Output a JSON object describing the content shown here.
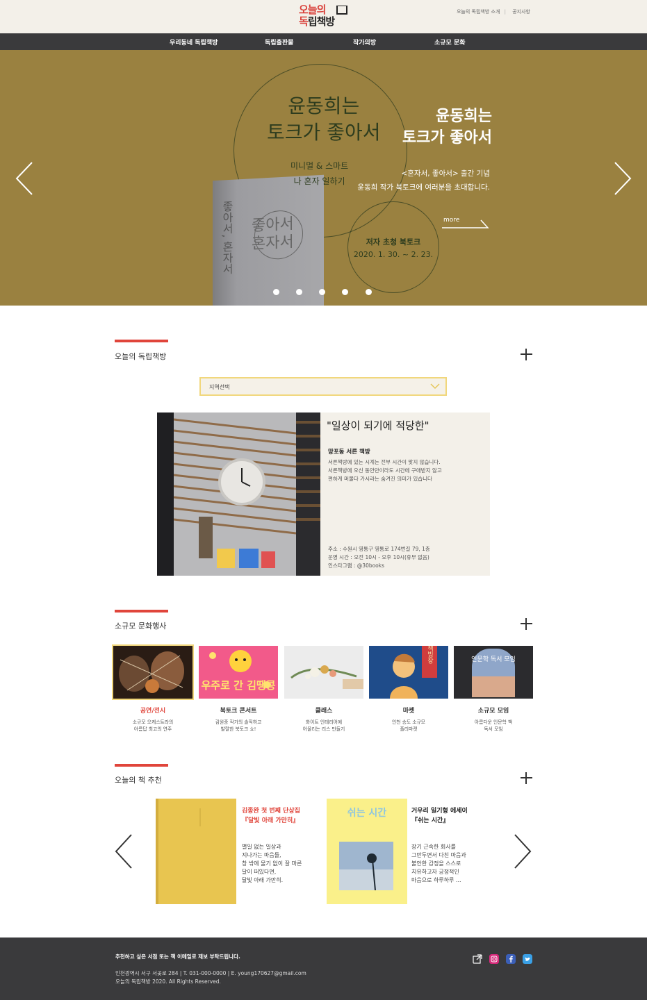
{
  "header": {
    "logo_line1": "오늘의",
    "logo_line2_red": "독",
    "logo_line2_rest": "립책방",
    "top_links": [
      "오늘의 독립책방 소개",
      "공지사항"
    ]
  },
  "nav": {
    "items": [
      "우리동네 독립책방",
      "독립출판물",
      "작가의방",
      "소규모 문화"
    ]
  },
  "hero": {
    "book_title_dark": [
      "윤동희는",
      "토크가 좋아서"
    ],
    "book_sub_dark": [
      "미니멀 & 스마트",
      "나 혼자 일하기"
    ],
    "book_spine": "좋아서, 혼자서",
    "book_cover": [
      "좋아서",
      "혼자서"
    ],
    "title_white": [
      "윤동희는",
      "토크가 좋아서"
    ],
    "desc": [
      "<혼자서, 좋아서> 출간 기념",
      "윤동희 작가 북토크에 여러분을 초대합니다."
    ],
    "more": "more",
    "event": "저자 초청 북토크",
    "date": "2020. 1. 30. ~ 2. 23.",
    "slide_count": 5,
    "active_slide": 1
  },
  "section_shops": {
    "title": "오늘의 독립책방",
    "region_placeholder": "지역선택",
    "quote": "\"일상이 되기에 적당한\"",
    "shop_name": "망포동 서른 책방",
    "desc": [
      "서른책방에 있는 시계는 전부 시간이 맞지 않습니다.",
      "서른책방에 오신 동안만이라도 시간에 구애받지 않고",
      "편하게 머물다 가시라는 숨겨진 의미가 있습니다"
    ],
    "info": [
      "주소 : 수원시 영통구 영통로 174번길 79, 1층",
      "운영 시간 : 오전 10시 - 오후 10시(휴무 없음)",
      "인스타그램 : @30books"
    ]
  },
  "section_events": {
    "title": "소규모 문화행사",
    "items": [
      {
        "name": "공연/전시",
        "desc": [
          "소규모 오케스트라의",
          "아름답 최고의 연주"
        ]
      },
      {
        "name": "북토크 콘서트",
        "desc": [
          "김원중 작가의 솔직하고",
          "발랄한 북토크 쇼!"
        ]
      },
      {
        "name": "클래스",
        "desc": [
          "화이트 인테리어에",
          "어울리는 리스 만들기"
        ]
      },
      {
        "name": "마켓",
        "desc": [
          "인천 송도 소규모",
          "플리마켓"
        ]
      },
      {
        "name": "소규모 모임",
        "desc": [
          "아름다운 인문학 책",
          "독서 모임"
        ]
      }
    ],
    "thumb_texts": {
      "concert": "우주로 간 김땡콩",
      "market": "책빙장",
      "meeting": "인문학 독서 모임"
    }
  },
  "section_books": {
    "title": "오늘의 책 추천",
    "book1": {
      "title": [
        "김종완 첫 번째 단상집",
        "『달빛 아래 가만히』"
      ],
      "desc": [
        "별일 없는 일상과",
        "지나가는 마음들,",
        "창 밖에 물기 없이 잘 마른",
        "달이 떠있다면,",
        "달빛 아래 가만히."
      ]
    },
    "book2": {
      "cover_title": "쉬는 시간",
      "title": [
        "거우리 일기형 에세이",
        "『쉬는 시간』"
      ],
      "desc": [
        "장기 근속한 회사를",
        "그만두면서 다친 마음과",
        "불안한 감정을 스스로",
        "치유하고자 긍정적인",
        "마음으로 하루하루 ..."
      ]
    }
  },
  "footer": {
    "request": "추천하고 싶은 서점 또는 책 이메일로 제보 부탁드립니다.",
    "address": "인천광역시 서구 서곶로 284 | T. 031-000-0000 | E. young170627@gmail.com",
    "copyright": "오늘의 독립책방 2020. All Rights Reserved."
  },
  "colors": {
    "accent_red": "#e0453b",
    "hero_bg": "#9a8140",
    "footer_bg": "#3a3a3c",
    "select_border": "#f1d77c"
  }
}
